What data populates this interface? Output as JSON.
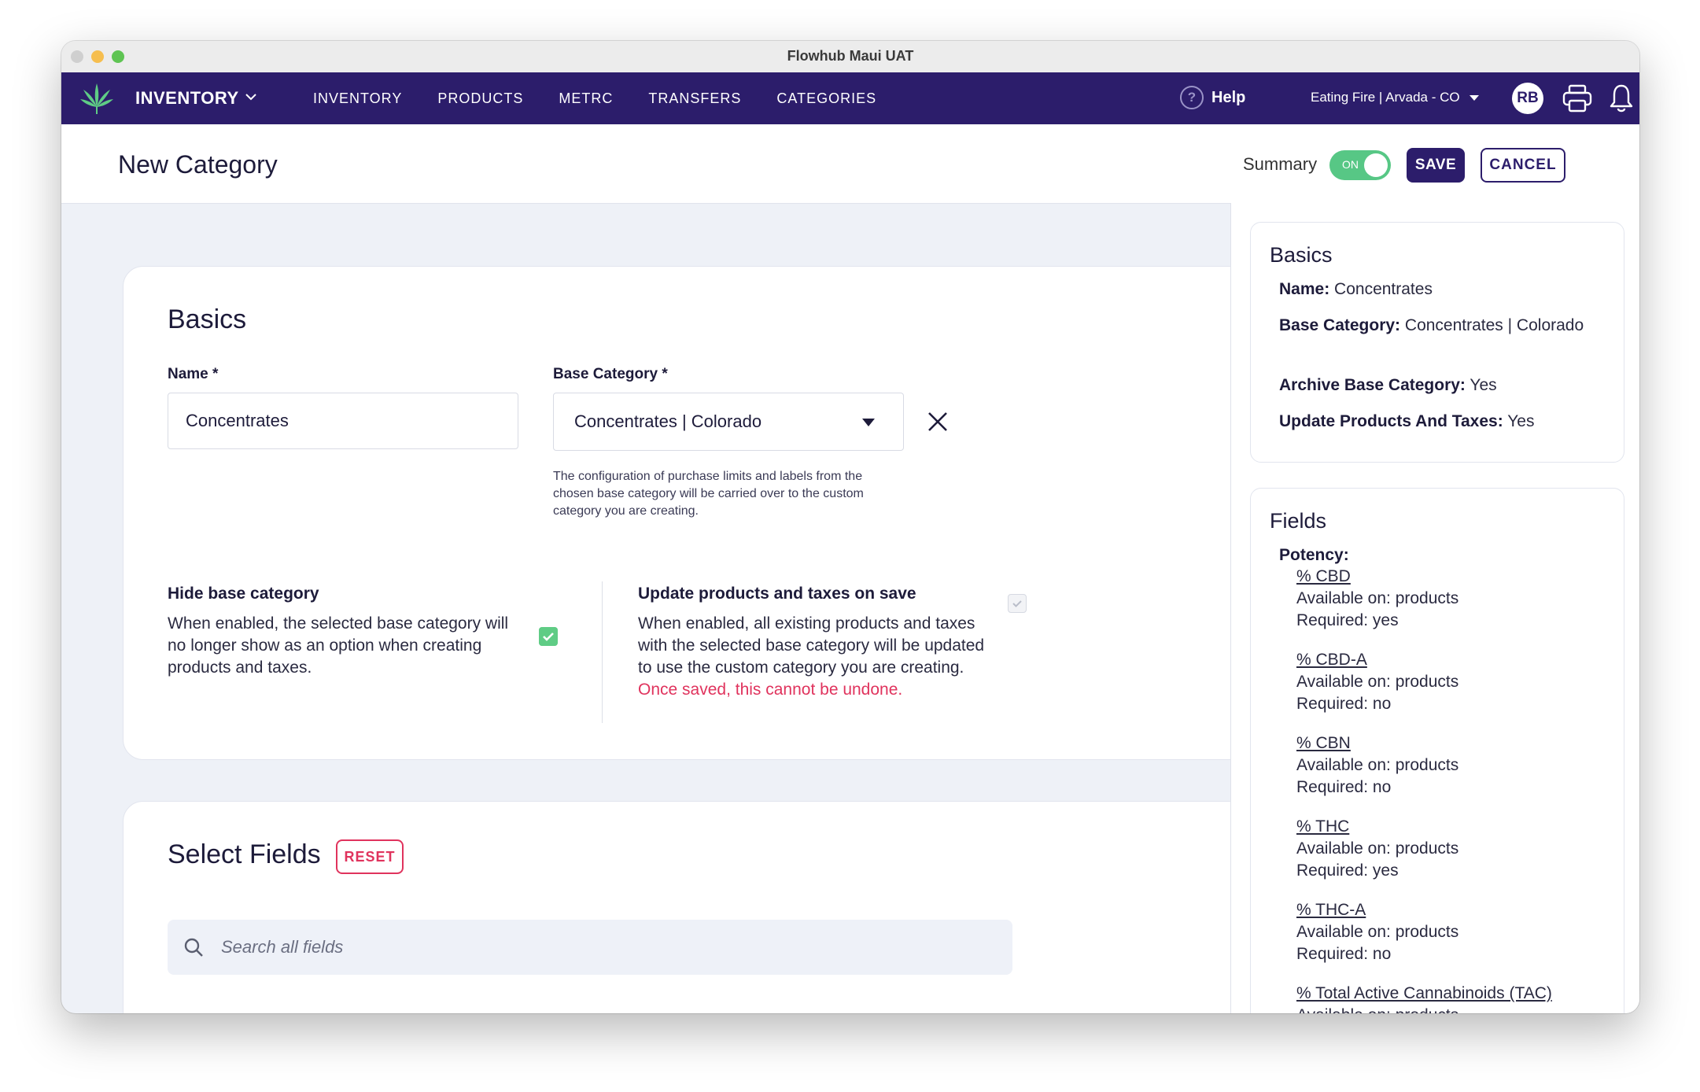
{
  "window": {
    "title": "Flowhub Maui UAT"
  },
  "nav": {
    "app_name": "INVENTORY",
    "links": [
      "INVENTORY",
      "PRODUCTS",
      "METRC",
      "TRANSFERS",
      "CATEGORIES"
    ],
    "help_label": "Help",
    "store_label": "Eating Fire | Arvada - CO",
    "avatar_initials": "RB"
  },
  "header": {
    "title": "New Category",
    "summary_label": "Summary",
    "summary_toggle": "ON",
    "save_label": "SAVE",
    "cancel_label": "CANCEL"
  },
  "basics": {
    "heading": "Basics",
    "name_label": "Name *",
    "name_value": "Concentrates",
    "base_category_label": "Base Category *",
    "base_category_value": "Concentrates | Colorado",
    "hint": "The configuration of purchase limits and labels from the chosen base category will be carried over to the custom category you are creating.",
    "hide_base": {
      "title": "Hide base category",
      "text": "When enabled, the selected base category will no longer show as an option when creating products and taxes.",
      "checked": true
    },
    "update_products": {
      "title": "Update products and taxes on save",
      "text": "When enabled, all existing products and taxes with the selected base category will be updated to use the custom category you are creating.",
      "warning": "Once saved, this cannot be undone.",
      "checked": false
    }
  },
  "select_fields": {
    "heading": "Select Fields",
    "reset_label": "RESET",
    "search_placeholder": "Search all fields"
  },
  "summary": {
    "basics_heading": "Basics",
    "basics_rows": [
      {
        "key": "Name:",
        "value": "Concentrates"
      },
      {
        "key": "Base Category:",
        "value": "Concentrates | Colorado"
      },
      {
        "key": "Archive Base Category:",
        "value": "Yes"
      },
      {
        "key": "Update Products And Taxes:",
        "value": "Yes"
      }
    ],
    "fields_heading": "Fields",
    "group_label": "Potency:",
    "fields": [
      {
        "name": "% CBD",
        "available": "Available on: products",
        "required": "Required: yes"
      },
      {
        "name": "% CBD-A",
        "available": "Available on: products",
        "required": "Required: no"
      },
      {
        "name": "% CBN",
        "available": "Available on: products",
        "required": "Required: no"
      },
      {
        "name": "% THC",
        "available": "Available on: products",
        "required": "Required: yes"
      },
      {
        "name": "% THC-A",
        "available": "Available on: products",
        "required": "Required: no"
      },
      {
        "name": "% Total Active Cannabinoids (TAC)",
        "available": "Available on: products",
        "required": ""
      }
    ]
  },
  "colors": {
    "nav_bg": "#2c1d6b",
    "toggle_on": "#57c785",
    "warning": "#e0335d",
    "check_on": "#5fcc85"
  }
}
